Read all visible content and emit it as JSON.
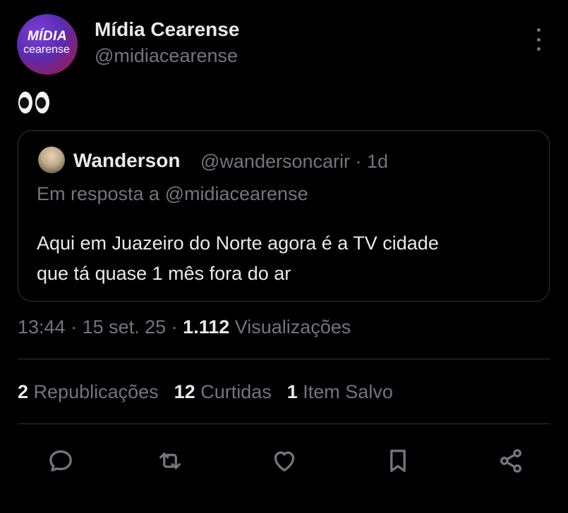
{
  "author": {
    "avatar_line1": "MÍDIA",
    "avatar_line2": "cearense",
    "name": "Mídia Cearense",
    "handle": "@midiacearense"
  },
  "tweet": {
    "emoji": "👀"
  },
  "quote": {
    "name": "Wanderson",
    "handle_time": "@wandersoncarir · 1d",
    "reply_to": "Em resposta a @midiacearense",
    "text_line1": "Aqui em Juazeiro do Norte agora é a TV cidade",
    "text_line2": "que tá quase 1 mês fora do ar"
  },
  "meta": {
    "time": "13:44",
    "sep1": " · ",
    "date": "15 set. 25",
    "sep2": " · ",
    "views_count": "1.112",
    "views_label": " Visualizações"
  },
  "stats": {
    "reposts_count": "2",
    "reposts_label": " Republicações",
    "likes_count": "12",
    "likes_label": " Curtidas",
    "saves_count": "1",
    "saves_label": " Item Salvo"
  },
  "actions": [
    "reply-icon",
    "repost-icon",
    "like-icon",
    "bookmark-icon",
    "share-icon"
  ]
}
